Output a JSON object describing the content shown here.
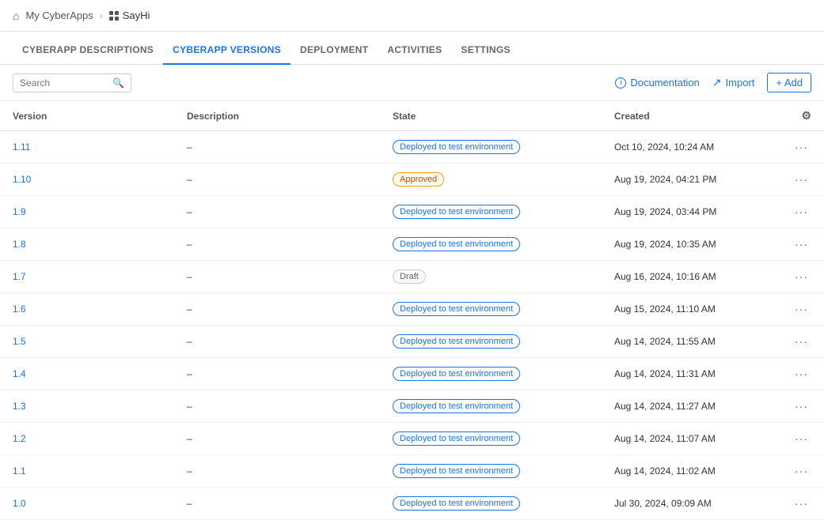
{
  "breadcrumb": {
    "parent_label": "My CyberApps",
    "separator": ">",
    "current_label": "SayHi"
  },
  "tabs": [
    {
      "id": "cyberapp-descriptions",
      "label": "CYBERAPP DESCRIPTIONS",
      "active": false
    },
    {
      "id": "cyberapp-versions",
      "label": "CYBERAPP VERSIONS",
      "active": true
    },
    {
      "id": "deployment",
      "label": "DEPLOYMENT",
      "active": false
    },
    {
      "id": "activities",
      "label": "ACTIVITIES",
      "active": false
    },
    {
      "id": "settings",
      "label": "SETTINGS",
      "active": false
    }
  ],
  "toolbar": {
    "search_placeholder": "Search",
    "documentation_label": "Documentation",
    "import_label": "Import",
    "add_label": "+ Add"
  },
  "table": {
    "columns": [
      {
        "id": "version",
        "label": "Version"
      },
      {
        "id": "description",
        "label": "Description"
      },
      {
        "id": "state",
        "label": "State"
      },
      {
        "id": "created",
        "label": "Created"
      }
    ],
    "rows": [
      {
        "version": "1.11",
        "description": "–",
        "state": "Deployed to test environment",
        "state_type": "deployed",
        "created": "Oct 10, 2024, 10:24 AM"
      },
      {
        "version": "1.10",
        "description": "–",
        "state": "Approved",
        "state_type": "approved",
        "created": "Aug 19, 2024, 04:21 PM"
      },
      {
        "version": "1.9",
        "description": "–",
        "state": "Deployed to test environment",
        "state_type": "deployed",
        "created": "Aug 19, 2024, 03:44 PM"
      },
      {
        "version": "1.8",
        "description": "–",
        "state": "Deployed to test environment",
        "state_type": "deployed",
        "created": "Aug 19, 2024, 10:35 AM"
      },
      {
        "version": "1.7",
        "description": "–",
        "state": "Draft",
        "state_type": "draft",
        "created": "Aug 16, 2024, 10:16 AM"
      },
      {
        "version": "1.6",
        "description": "–",
        "state": "Deployed to test environment",
        "state_type": "deployed",
        "created": "Aug 15, 2024, 11:10 AM"
      },
      {
        "version": "1.5",
        "description": "–",
        "state": "Deployed to test environment",
        "state_type": "deployed",
        "created": "Aug 14, 2024, 11:55 AM"
      },
      {
        "version": "1.4",
        "description": "–",
        "state": "Deployed to test environment",
        "state_type": "deployed",
        "created": "Aug 14, 2024, 11:31 AM"
      },
      {
        "version": "1.3",
        "description": "–",
        "state": "Deployed to test environment",
        "state_type": "deployed",
        "created": "Aug 14, 2024, 11:27 AM"
      },
      {
        "version": "1.2",
        "description": "–",
        "state": "Deployed to test environment",
        "state_type": "deployed",
        "created": "Aug 14, 2024, 11:07 AM"
      },
      {
        "version": "1.1",
        "description": "–",
        "state": "Deployed to test environment",
        "state_type": "deployed",
        "created": "Aug 14, 2024, 11:02 AM"
      },
      {
        "version": "1.0",
        "description": "–",
        "state": "Deployed to test environment",
        "state_type": "deployed",
        "created": "Jul 30, 2024, 09:09 AM"
      }
    ]
  }
}
